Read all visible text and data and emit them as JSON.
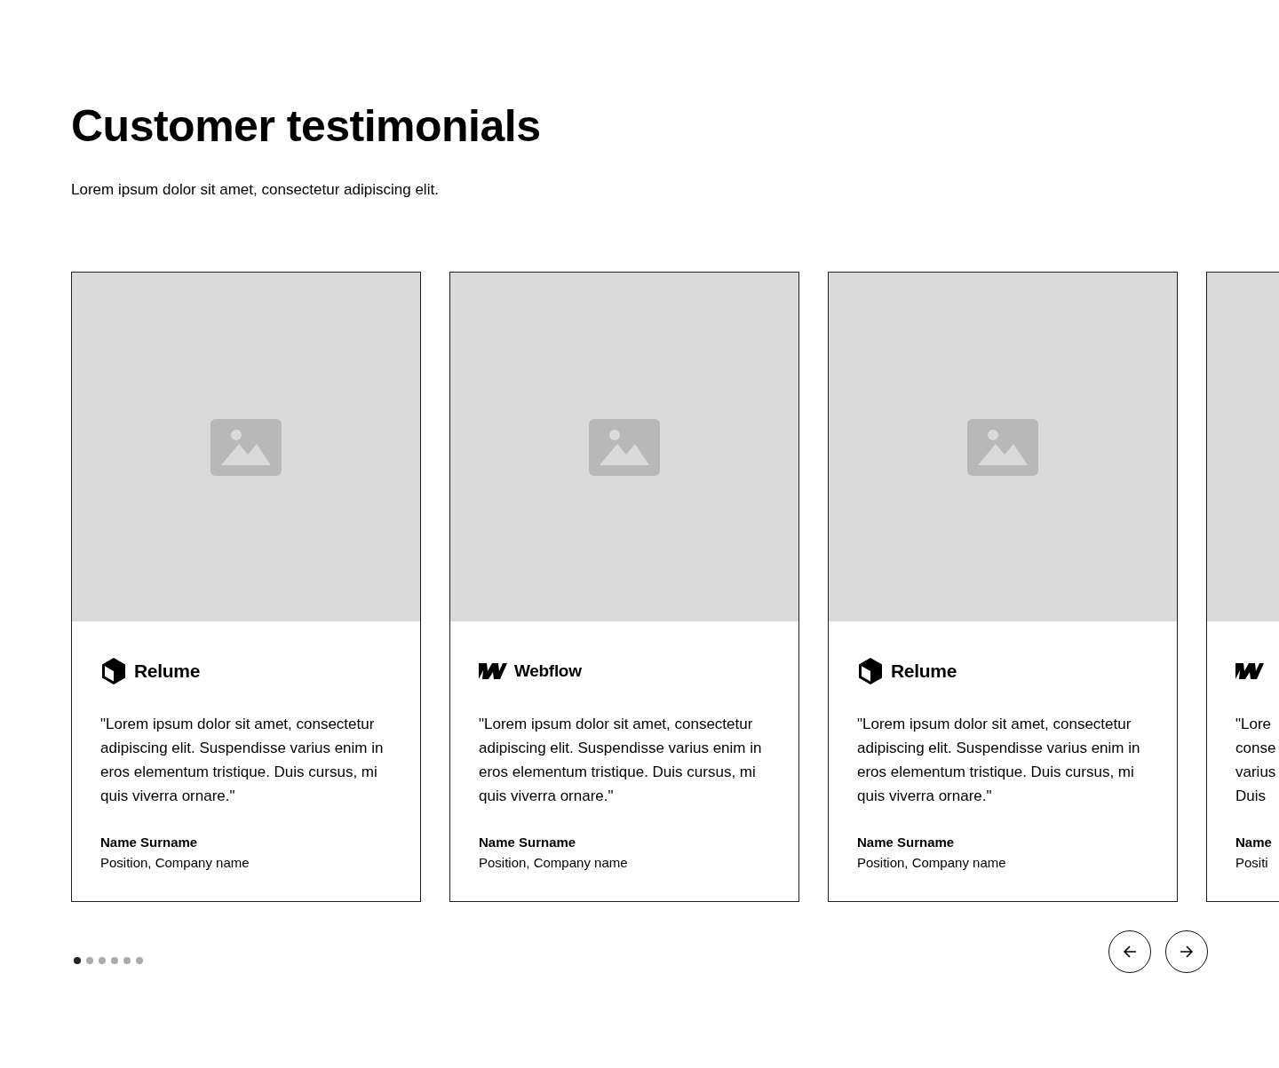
{
  "header": {
    "title": "Customer testimonials",
    "subtitle": "Lorem ipsum dolor sit amet, consectetur adipiscing elit."
  },
  "cards": [
    {
      "kind": "full",
      "logo": {
        "kind": "relume",
        "text": "Relume"
      },
      "quote": "\"Lorem ipsum dolor sit amet, consectetur adipiscing elit. Suspendisse varius enim in eros elementum tristique. Duis cursus, mi quis viverra ornare.\"",
      "name": "Name Surname",
      "position": "Position, Company name"
    },
    {
      "kind": "full",
      "logo": {
        "kind": "webflow",
        "text": "Webflow"
      },
      "quote": "\"Lorem ipsum dolor sit amet, consectetur adipiscing elit. Suspendisse varius enim in eros elementum tristique. Duis cursus, mi quis viverra ornare.\"",
      "name": "Name Surname",
      "position": "Position, Company name"
    },
    {
      "kind": "full",
      "logo": {
        "kind": "relume",
        "text": "Relume"
      },
      "quote": "\"Lorem ipsum dolor sit amet, consectetur adipiscing elit. Suspendisse varius enim in eros elementum tristique. Duis cursus, mi quis viverra ornare.\"",
      "name": "Name Surname",
      "position": "Position, Company name"
    },
    {
      "kind": "partial",
      "logo": {
        "kind": "webflow"
      },
      "quote_lines": [
        "\"Lore",
        "conse",
        "varius",
        "Duis"
      ],
      "name": "Name",
      "position": "Positi"
    }
  ],
  "dots": [
    {
      "selected": true
    },
    {
      "selected": false
    },
    {
      "selected": false
    },
    {
      "selected": false
    },
    {
      "selected": false
    },
    {
      "selected": false
    }
  ],
  "controls": [
    {
      "kind": "previous"
    },
    {
      "kind": "next"
    }
  ]
}
